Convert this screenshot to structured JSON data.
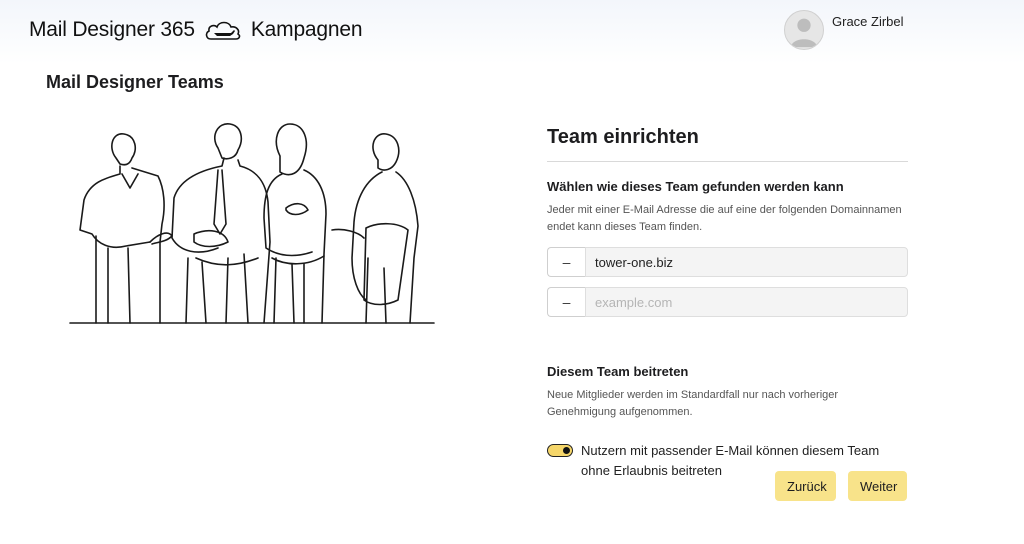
{
  "header": {
    "brand_left": "Mail Designer 365",
    "brand_right": "Kampagnen",
    "brand_icon": "cloud-airplane-icon",
    "user_name": "Grace Zirbel"
  },
  "page": {
    "title": "Mail Designer Teams"
  },
  "panel": {
    "title": "Team einrichten",
    "find": {
      "title": "Wählen wie dieses Team gefunden werden kann",
      "description": "Jeder mit einer E-Mail Adresse die auf eine der folgenden Domainnamen endet kann dieses Team finden.",
      "remove_label": "–",
      "domains": [
        {
          "value": "tower-one.biz",
          "placeholder": ""
        },
        {
          "value": "",
          "placeholder": "example.com"
        }
      ]
    },
    "join": {
      "title": "Diesem Team beitreten",
      "description": "Neue Mitglieder werden im Standardfall nur nach vorheriger Genehmigung aufgenommen.",
      "toggle_label": "Nutzern mit passender E-Mail können diesem Team ohne Erlaubnis beitreten",
      "toggle_on": true
    }
  },
  "buttons": {
    "back": "Zurück",
    "next": "Weiter"
  },
  "colors": {
    "accent_button": "#f8e38a",
    "toggle_on": "#f5d66a"
  }
}
